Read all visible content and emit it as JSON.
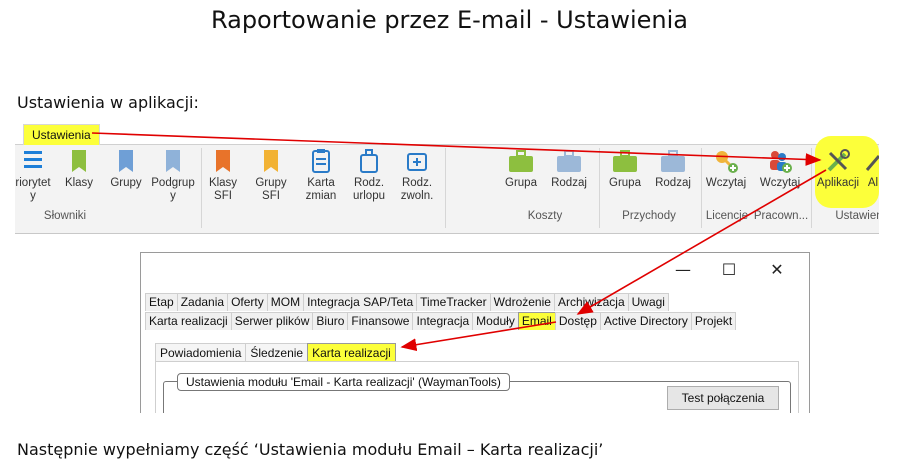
{
  "doc": {
    "title": "Raportowanie przez E-mail - Ustawienia",
    "intro": "Ustawienia w aplikacji:",
    "footer": "Następnie wypełniamy część ‘Ustawienia modułu Email – Karta realizacji’"
  },
  "ribbon": {
    "tab": "Ustawienia",
    "groups": {
      "slowniki": "Słowniki",
      "koszty": "Koszty",
      "przychody": "Przychody",
      "licencje": "Licencje",
      "pracownicy": "Pracown...",
      "ustawienia": "Ustawien"
    },
    "buttons": {
      "priorytety": "riorytet\ny",
      "klasy": "Klasy",
      "grupy": "Grupy",
      "podgrupy": "Podgrup\ny",
      "klasy_sfi": "Klasy\nSFI",
      "grupy_sfi": "Grupy\nSFI",
      "karta_zmian": "Karta\nzmian",
      "rodz_urlopu": "Rodz.\nurlopu",
      "rodz_zwoln": "Rodz.\nzwoln.",
      "koszty_grupa": "Grupa",
      "koszty_rodzaj": "Rodzaj",
      "przychody_grupa": "Grupa",
      "przychody_rodzaj": "Rodzaj",
      "wczytaj_lic": "Wczytaj",
      "wczytaj_prac": "Wczytaj",
      "aplikacji": "Aplikacji",
      "al": "Al"
    }
  },
  "dialog": {
    "controls": {
      "minimize": "—",
      "maximize": "☐",
      "close": "✕"
    },
    "tabs_row1": [
      "Etap",
      "Zadania",
      "Oferty",
      "MOM",
      "Integracja SAP/Teta",
      "TimeTracker",
      "Wdrożenie",
      "Archiwizacja",
      "Uwagi"
    ],
    "tabs_row2": [
      "Karta realizacji",
      "Serwer plików",
      "Biuro",
      "Finansowe",
      "Integracja",
      "Moduły",
      "Email",
      "Dostęp",
      "Active Directory",
      "Projekt"
    ],
    "selected_tab": "Email",
    "subtabs": [
      "Powiadomienia",
      "Śledzenie",
      "Karta realizacji"
    ],
    "selected_subtab": "Karta realizacji",
    "groupbox_title": "Ustawienia modułu 'Email - Karta realizacji' (WaymanTools)",
    "test_button": "Test połączenia"
  },
  "colors": {
    "highlight": "#fcff3a",
    "arrow": "#e00000"
  },
  "icons": [
    "clipboard-icon",
    "bookmark-icon",
    "briefcase-icon",
    "key-icon",
    "user-add-icon",
    "tools-icon"
  ]
}
